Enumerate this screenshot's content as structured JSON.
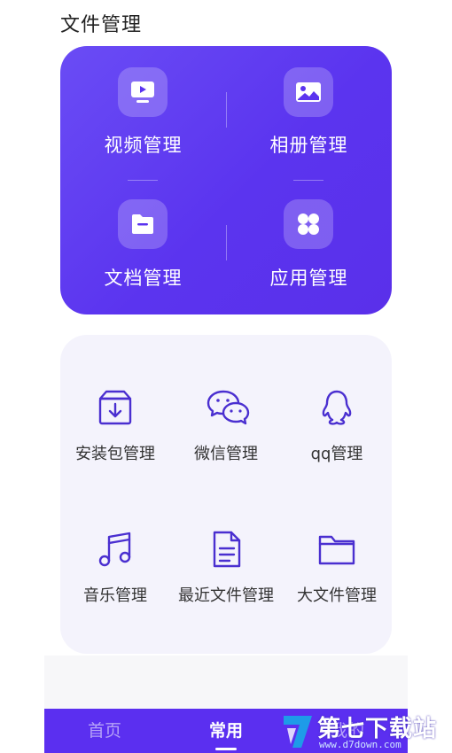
{
  "section_title": "文件管理",
  "purple_card": {
    "items": [
      {
        "label": "视频管理",
        "icon": "video-icon"
      },
      {
        "label": "相册管理",
        "icon": "photo-album-icon"
      },
      {
        "label": "文档管理",
        "icon": "document-folder-icon"
      },
      {
        "label": "应用管理",
        "icon": "apps-grid-icon"
      }
    ]
  },
  "tools": {
    "items": [
      {
        "label": "安装包管理",
        "icon": "package-download-icon"
      },
      {
        "label": "微信管理",
        "icon": "wechat-icon"
      },
      {
        "label": "qq管理",
        "icon": "qq-icon"
      },
      {
        "label": "音乐管理",
        "icon": "music-note-icon"
      },
      {
        "label": "最近文件管理",
        "icon": "recent-file-icon"
      },
      {
        "label": "大文件管理",
        "icon": "folder-icon"
      }
    ]
  },
  "bottom_nav": {
    "tabs": [
      {
        "label": "首页",
        "active": false
      },
      {
        "label": "常用",
        "active": true
      },
      {
        "label": "我的",
        "active": false
      }
    ]
  },
  "watermark": {
    "text": "第七下载站",
    "url": "www.d7down.com"
  },
  "colors": {
    "primary": "#5b34ef",
    "card_bg": "#f4f3fc",
    "icon_stroke": "#4a2fd0"
  }
}
